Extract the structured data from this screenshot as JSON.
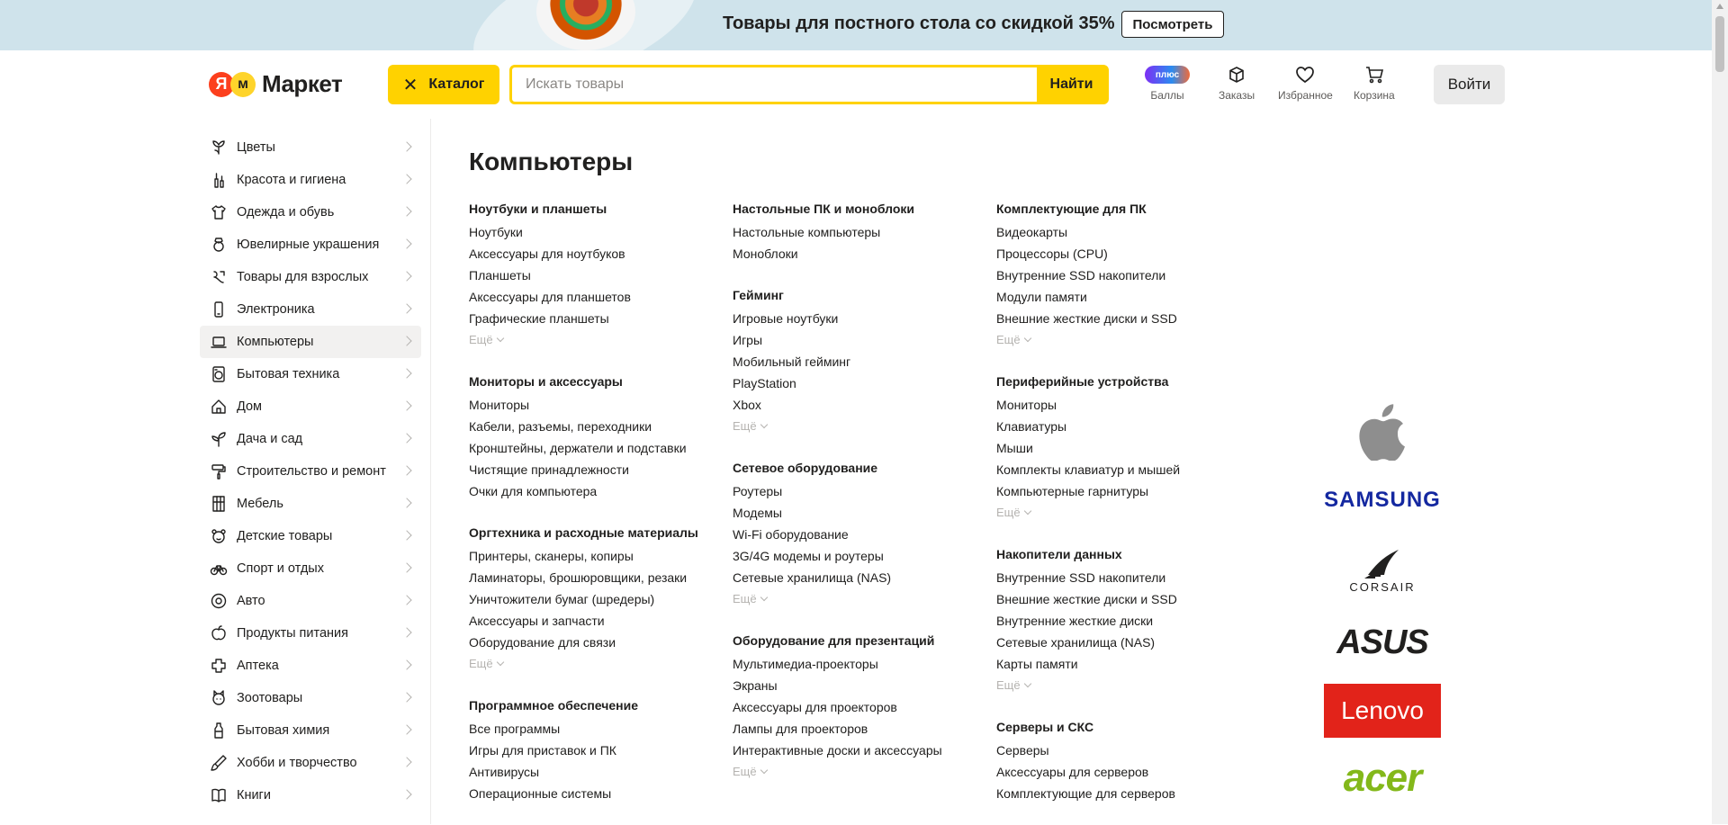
{
  "banner": {
    "title": "Товары для постного стола со скидкой 35%",
    "button": "Посмотреть"
  },
  "header": {
    "logo": "Маркет",
    "catalog_label": "Каталог",
    "search_placeholder": "Искать товары",
    "search_button": "Найти",
    "nav": [
      {
        "label": "Баллы",
        "icon": "plus-badge-icon",
        "badge": "плюс"
      },
      {
        "label": "Заказы",
        "icon": "box-icon"
      },
      {
        "label": "Избранное",
        "icon": "heart-icon"
      },
      {
        "label": "Корзина",
        "icon": "cart-icon"
      }
    ],
    "login": "Войти"
  },
  "sidebar": {
    "active_index": 6,
    "items": [
      {
        "label": "Цветы",
        "icon": "flower-icon"
      },
      {
        "label": "Красота и гигиена",
        "icon": "cosmetics-icon"
      },
      {
        "label": "Одежда и обувь",
        "icon": "clothes-icon"
      },
      {
        "label": "Ювелирные украшения",
        "icon": "jewelry-icon"
      },
      {
        "label": "Товары для взрослых",
        "icon": "adult-icon"
      },
      {
        "label": "Электроника",
        "icon": "phone-icon"
      },
      {
        "label": "Компьютеры",
        "icon": "laptop-icon"
      },
      {
        "label": "Бытовая техника",
        "icon": "washer-icon"
      },
      {
        "label": "Дом",
        "icon": "house-icon"
      },
      {
        "label": "Дача и сад",
        "icon": "plant-icon"
      },
      {
        "label": "Строительство и ремонт",
        "icon": "paint-roller-icon"
      },
      {
        "label": "Мебель",
        "icon": "furniture-icon"
      },
      {
        "label": "Детские товары",
        "icon": "bear-icon"
      },
      {
        "label": "Спорт и отдых",
        "icon": "bike-icon"
      },
      {
        "label": "Авто",
        "icon": "wheel-icon"
      },
      {
        "label": "Продукты питания",
        "icon": "apple-icon"
      },
      {
        "label": "Аптека",
        "icon": "cross-icon"
      },
      {
        "label": "Зоотовары",
        "icon": "cat-icon"
      },
      {
        "label": "Бытовая химия",
        "icon": "bottle-icon"
      },
      {
        "label": "Хобби и творчество",
        "icon": "brush-icon"
      },
      {
        "label": "Книги",
        "icon": "book-icon"
      }
    ]
  },
  "content": {
    "title": "Компьютеры",
    "more_label": "Ещё",
    "columns": [
      [
        {
          "title": "Ноутбуки и планшеты",
          "links": [
            "Ноутбуки",
            "Аксессуары для ноутбуков",
            "Планшеты",
            "Аксессуары для планшетов",
            "Графические планшеты"
          ],
          "more": true
        },
        {
          "title": "Мониторы и аксессуары",
          "links": [
            "Мониторы",
            "Кабели, разъемы, переходники",
            "Кронштейны, держатели и подставки",
            "Чистящие принадлежности",
            "Очки для компьютера"
          ],
          "more": false
        },
        {
          "title": "Оргтехника и расходные материалы",
          "links": [
            "Принтеры, сканеры, копиры",
            "Ламинаторы, брошюровщики, резаки",
            "Уничтожители бумаг (шредеры)",
            "Аксессуары и запчасти",
            "Оборудование для связи"
          ],
          "more": true
        },
        {
          "title": "Программное обеспечение",
          "links": [
            "Все программы",
            "Игры для приставок и ПК",
            "Антивирусы",
            "Операционные системы"
          ],
          "more": false
        }
      ],
      [
        {
          "title": "Настольные ПК и моноблоки",
          "links": [
            "Настольные компьютеры",
            "Моноблоки"
          ],
          "more": false
        },
        {
          "title": "Гейминг",
          "links": [
            "Игровые ноутбуки",
            "Игры",
            "Мобильный гейминг",
            "PlayStation",
            "Xbox"
          ],
          "more": true
        },
        {
          "title": "Сетевое оборудование",
          "links": [
            "Роутеры",
            "Модемы",
            "Wi-Fi оборудование",
            "3G/4G модемы и роутеры",
            "Сетевые хранилища (NAS)"
          ],
          "more": true
        },
        {
          "title": "Оборудование для презентаций",
          "links": [
            "Мультимедиа-проекторы",
            "Экраны",
            "Аксессуары для проекторов",
            "Лампы для проекторов",
            "Интерактивные доски и аксессуары"
          ],
          "more": true
        }
      ],
      [
        {
          "title": "Комплектующие для ПК",
          "links": [
            "Видеокарты",
            "Процессоры (CPU)",
            "Внутренние SSD накопители",
            "Модули памяти",
            "Внешние жесткие диски и SSD"
          ],
          "more": true
        },
        {
          "title": "Периферийные устройства",
          "links": [
            "Мониторы",
            "Клавиатуры",
            "Мыши",
            "Комплекты клавиатур и мышей",
            "Компьютерные гарнитуры"
          ],
          "more": true
        },
        {
          "title": "Накопители данных",
          "links": [
            "Внутренние SSD накопители",
            "Внешние жесткие диски и SSD",
            "Внутренние жесткие диски",
            "Сетевые хранилища (NAS)",
            "Карты памяти"
          ],
          "more": true
        },
        {
          "title": "Серверы и СКС",
          "links": [
            "Серверы",
            "Аксессуары для серверов",
            "Комплектующие для серверов"
          ],
          "more": false
        }
      ]
    ]
  },
  "brands": {
    "items": [
      {
        "name": "Apple",
        "icon": "apple-logo-icon"
      },
      {
        "name": "SAMSUNG",
        "icon": "samsung-logo-icon"
      },
      {
        "name": "CORSAIR",
        "icon": "corsair-logo-icon"
      },
      {
        "name": "ASUS",
        "icon": "asus-logo-icon"
      },
      {
        "name": "Lenovo",
        "icon": "lenovo-logo-icon"
      },
      {
        "name": "acer",
        "icon": "acer-logo-icon"
      }
    ]
  },
  "colors": {
    "accent": "#ffd200",
    "banner_bg": "#cfe3eb",
    "lenovo_red": "#e2231a",
    "acer_green": "#83b81a",
    "samsung_blue": "#1428a0"
  }
}
